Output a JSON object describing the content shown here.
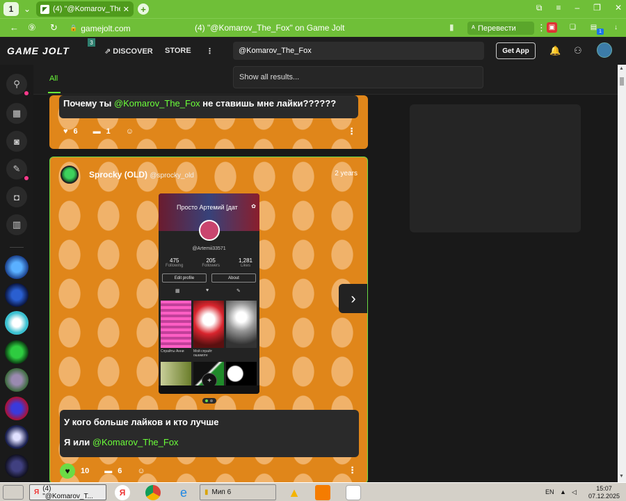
{
  "browser": {
    "tab_count": "1",
    "tab_title": "(4) \"@Komarov_The_Fo",
    "url": "gamejolt.com",
    "page_title": "(4) \"@Komarov_The_Fox\" on Game Jolt",
    "translate_label": "Перевести",
    "ext_badge": "1"
  },
  "header": {
    "logo": "GAME JOLT",
    "logo_badge": "3",
    "nav_discover": "DISCOVER",
    "nav_store": "STORE",
    "search_value": "@Komarov_The_Fox",
    "search_dropdown": "Show all results...",
    "get_app": "Get App"
  },
  "feed": {
    "tab_all": "All"
  },
  "post1": {
    "text_before": "Почему ты ",
    "mention": "@Komarov_The_Fox",
    "text_after": "  не ставишь мне лайки??????",
    "likes": "6",
    "comments": "1"
  },
  "post2": {
    "author": "Sprocky (OLD)",
    "handle": "@sprocky_old",
    "time": "2 years",
    "line1": "У кого больше лайков и кто лучше",
    "line2_before": "Я или ",
    "mention": "@Komarov_The_Fox",
    "likes": "10",
    "comments": "6",
    "phone": {
      "title": "Просто Артемий [дат",
      "username": "@Artemii33571",
      "stats": [
        {
          "value": "475",
          "label": "Following"
        },
        {
          "value": "205",
          "label": "Followers"
        },
        {
          "value": "1,281",
          "label": "Likes"
        }
      ],
      "btn_edit": "Edit profile",
      "btn_about": "About",
      "cap1": "Спрайты Анни",
      "cap2": "Мой спрайт\nошамоте"
    }
  },
  "taskbar": {
    "task1": "(4) \"@Komarov_T...",
    "task2": "Мип 6",
    "lang": "EN",
    "time": "15:07",
    "date": "07.12.2025"
  }
}
